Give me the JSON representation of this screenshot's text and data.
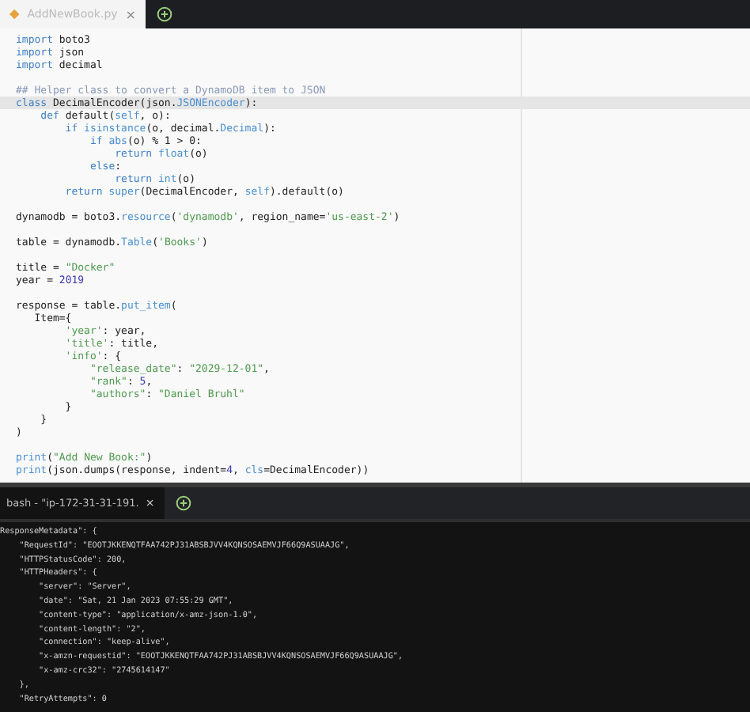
{
  "editor_tabs": [
    {
      "label": "AddNewBook.py",
      "selected": true,
      "close": "×"
    }
  ],
  "code_lines": [
    {
      "kind": "code",
      "current": false,
      "tokens": [
        {
          "t": "import",
          "kind": "keyword"
        },
        {
          "t": " boto3",
          "kind": "plain"
        }
      ]
    },
    {
      "kind": "code",
      "current": false,
      "tokens": [
        {
          "t": "import",
          "kind": "keyword"
        },
        {
          "t": " json",
          "kind": "plain"
        }
      ]
    },
    {
      "kind": "code",
      "current": false,
      "tokens": [
        {
          "t": "import",
          "kind": "keyword"
        },
        {
          "t": " decimal",
          "kind": "plain"
        }
      ]
    },
    {
      "kind": "blank"
    },
    {
      "kind": "code",
      "current": false,
      "tokens": [
        {
          "t": "## Helper class to convert a DynamoDB item to JSON",
          "kind": "comment"
        }
      ]
    },
    {
      "kind": "code",
      "current": true,
      "tokens": [
        {
          "t": "class",
          "kind": "keyword"
        },
        {
          "t": " DecimalEncoder(json.",
          "kind": "plain"
        },
        {
          "t": "JSONEncoder",
          "kind": "builtin"
        },
        {
          "t": "):",
          "kind": "plain"
        }
      ]
    },
    {
      "kind": "code",
      "current": false,
      "tokens": [
        {
          "t": "    def",
          "kind": "keyword"
        },
        {
          "t": " default(",
          "kind": "plain"
        },
        {
          "t": "self",
          "kind": "builtin"
        },
        {
          "t": ", o):",
          "kind": "plain"
        }
      ]
    },
    {
      "kind": "code",
      "current": false,
      "tokens": [
        {
          "t": "        if",
          "kind": "keyword"
        },
        {
          "t": " isinstance",
          "kind": "builtin"
        },
        {
          "t": "(o, decimal.",
          "kind": "plain"
        },
        {
          "t": "Decimal",
          "kind": "builtin"
        },
        {
          "t": "):",
          "kind": "plain"
        }
      ]
    },
    {
      "kind": "code",
      "current": false,
      "tokens": [
        {
          "t": "            if",
          "kind": "keyword"
        },
        {
          "t": " abs",
          "kind": "builtin"
        },
        {
          "t": "(o) % 1 > 0:",
          "kind": "plain"
        }
      ]
    },
    {
      "kind": "code",
      "current": false,
      "tokens": [
        {
          "t": "                return",
          "kind": "keyword"
        },
        {
          "t": " float",
          "kind": "builtin"
        },
        {
          "t": "(o)",
          "kind": "plain"
        }
      ]
    },
    {
      "kind": "code",
      "current": false,
      "tokens": [
        {
          "t": "            else",
          "kind": "keyword"
        },
        {
          "t": ":",
          "kind": "plain"
        }
      ]
    },
    {
      "kind": "code",
      "current": false,
      "tokens": [
        {
          "t": "                return",
          "kind": "keyword"
        },
        {
          "t": " int",
          "kind": "builtin"
        },
        {
          "t": "(o)",
          "kind": "plain"
        }
      ]
    },
    {
      "kind": "code",
      "current": false,
      "tokens": [
        {
          "t": "        return",
          "kind": "keyword"
        },
        {
          "t": " super",
          "kind": "builtin"
        },
        {
          "t": "(DecimalEncoder, ",
          "kind": "plain"
        },
        {
          "t": "self",
          "kind": "builtin"
        },
        {
          "t": ").default(o)",
          "kind": "plain"
        }
      ]
    },
    {
      "kind": "blank"
    },
    {
      "kind": "code",
      "current": false,
      "tokens": [
        {
          "t": "dynamodb = boto3.",
          "kind": "plain"
        },
        {
          "t": "resource",
          "kind": "builtin"
        },
        {
          "t": "(",
          "kind": "plain"
        },
        {
          "t": "'dynamodb'",
          "kind": "string"
        },
        {
          "t": ", region_name=",
          "kind": "plain"
        },
        {
          "t": "'us-east-2'",
          "kind": "string"
        },
        {
          "t": ")",
          "kind": "plain"
        }
      ]
    },
    {
      "kind": "blank"
    },
    {
      "kind": "code",
      "current": false,
      "tokens": [
        {
          "t": "table = dynamodb.",
          "kind": "plain"
        },
        {
          "t": "Table",
          "kind": "builtin"
        },
        {
          "t": "(",
          "kind": "plain"
        },
        {
          "t": "'Books'",
          "kind": "string"
        },
        {
          "t": ")",
          "kind": "plain"
        }
      ]
    },
    {
      "kind": "blank"
    },
    {
      "kind": "code",
      "current": false,
      "tokens": [
        {
          "t": "title = ",
          "kind": "plain"
        },
        {
          "t": "\"Docker\"",
          "kind": "string"
        }
      ]
    },
    {
      "kind": "code",
      "current": false,
      "tokens": [
        {
          "t": "year = ",
          "kind": "plain"
        },
        {
          "t": "2019",
          "kind": "number"
        }
      ]
    },
    {
      "kind": "blank"
    },
    {
      "kind": "code",
      "current": false,
      "tokens": [
        {
          "t": "response = table.",
          "kind": "plain"
        },
        {
          "t": "put_item",
          "kind": "builtin"
        },
        {
          "t": "(",
          "kind": "plain"
        }
      ]
    },
    {
      "kind": "code",
      "current": false,
      "tokens": [
        {
          "t": "   Item={",
          "kind": "plain"
        }
      ]
    },
    {
      "kind": "code",
      "current": false,
      "tokens": [
        {
          "t": "        'year'",
          "kind": "string"
        },
        {
          "t": ": year,",
          "kind": "plain"
        }
      ]
    },
    {
      "kind": "code",
      "current": false,
      "tokens": [
        {
          "t": "        'title'",
          "kind": "string"
        },
        {
          "t": ": title,",
          "kind": "plain"
        }
      ]
    },
    {
      "kind": "code",
      "current": false,
      "tokens": [
        {
          "t": "        'info'",
          "kind": "string"
        },
        {
          "t": ": {",
          "kind": "plain"
        }
      ]
    },
    {
      "kind": "code",
      "current": false,
      "tokens": [
        {
          "t": "            \"release_date\"",
          "kind": "string"
        },
        {
          "t": ": ",
          "kind": "plain"
        },
        {
          "t": "\"2029-12-01\"",
          "kind": "string"
        },
        {
          "t": ",",
          "kind": "plain"
        }
      ]
    },
    {
      "kind": "code",
      "current": false,
      "tokens": [
        {
          "t": "            \"rank\"",
          "kind": "string"
        },
        {
          "t": ": ",
          "kind": "plain"
        },
        {
          "t": "5",
          "kind": "number"
        },
        {
          "t": ",",
          "kind": "plain"
        }
      ]
    },
    {
      "kind": "code",
      "current": false,
      "tokens": [
        {
          "t": "            \"authors\"",
          "kind": "string"
        },
        {
          "t": ": ",
          "kind": "plain"
        },
        {
          "t": "\"Daniel Bruhl\"",
          "kind": "string"
        }
      ]
    },
    {
      "kind": "code",
      "current": false,
      "tokens": [
        {
          "t": "        }",
          "kind": "plain"
        }
      ]
    },
    {
      "kind": "code",
      "current": false,
      "tokens": [
        {
          "t": "    }",
          "kind": "plain"
        }
      ]
    },
    {
      "kind": "code",
      "current": false,
      "tokens": [
        {
          "t": ")",
          "kind": "plain"
        }
      ]
    },
    {
      "kind": "blank"
    },
    {
      "kind": "code",
      "current": false,
      "tokens": [
        {
          "t": "print",
          "kind": "builtin"
        },
        {
          "t": "(",
          "kind": "plain"
        },
        {
          "t": "\"Add New Book:\"",
          "kind": "string"
        },
        {
          "t": ")",
          "kind": "plain"
        }
      ]
    },
    {
      "kind": "code",
      "current": false,
      "tokens": [
        {
          "t": "print",
          "kind": "builtin"
        },
        {
          "t": "(json.dumps(response, indent=",
          "kind": "plain"
        },
        {
          "t": "4",
          "kind": "number"
        },
        {
          "t": ", ",
          "kind": "plain"
        },
        {
          "t": "cls",
          "kind": "builtin"
        },
        {
          "t": "=DecimalEncoder))",
          "kind": "plain"
        }
      ]
    }
  ],
  "terminal_tabs": [
    {
      "label": "bash - \"ip-172-31-31-191.",
      "selected": true,
      "close": "×"
    }
  ],
  "terminal_lines": [
    "ResponseMetadata\": {",
    "    \"RequestId\": \"EOOTJKKENQTFAA742PJ31ABSBJVV4KQNSOSAEMVJF66Q9ASUAAJG\",",
    "    \"HTTPStatusCode\": 200,",
    "    \"HTTPHeaders\": {",
    "        \"server\": \"Server\",",
    "        \"date\": \"Sat, 21 Jan 2023 07:55:29 GMT\",",
    "        \"content-type\": \"application/x-amz-json-1.0\",",
    "        \"content-length\": \"2\",",
    "        \"connection\": \"keep-alive\",",
    "        \"x-amzn-requestid\": \"EOOTJKKENQTFAA742PJ31ABSBJVV4KQNSOSAEMVJF66Q9ASUAAJG\",",
    "        \"x-amz-crc32\": \"2745614147\"",
    "    },",
    "    \"RetryAttempts\": 0"
  ]
}
